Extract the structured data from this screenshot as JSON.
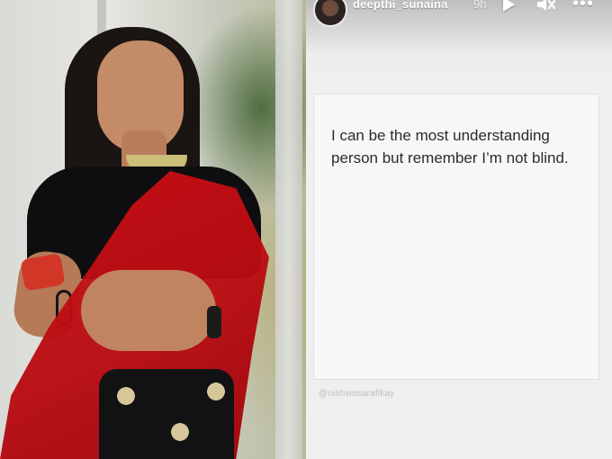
{
  "story": {
    "username": "deepthi_sunaina",
    "time": "9h",
    "quote": "I can be the most understanding person but remember I’m not blind.",
    "watermark": "@nishwasarafikay"
  },
  "icons": {
    "avatar": "avatar",
    "play": "play-icon",
    "mute": "muted-volume-icon",
    "more": "more-icon"
  },
  "colors": {
    "saree_red": "#c40f17",
    "story_bg": "#efefef",
    "text_dark": "#2b2b2b"
  }
}
